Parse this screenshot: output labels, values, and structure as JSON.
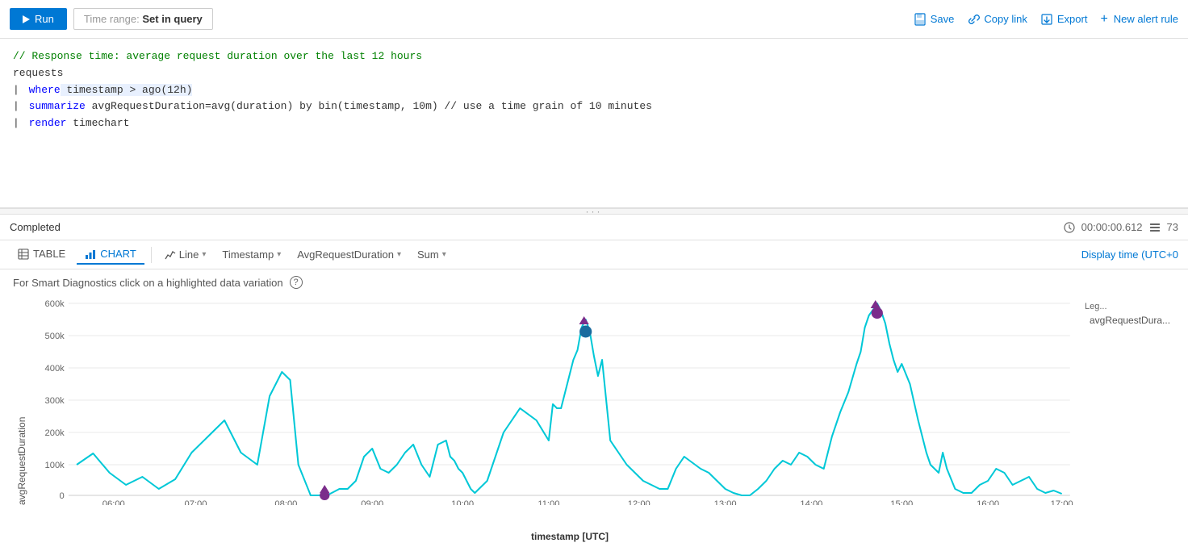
{
  "toolbar": {
    "run_label": "Run",
    "time_range_prefix": "Time range:",
    "time_range_value": "Set in query",
    "save_label": "Save",
    "copy_link_label": "Copy link",
    "export_label": "Export",
    "new_alert_label": "New alert rule"
  },
  "query": {
    "comment": "// Response time: average request duration over the last 12 hours",
    "line1": "requests",
    "line2_pipe": "|",
    "line2_keyword": "where",
    "line2_rest": " timestamp > ago(12h)",
    "line3_pipe": "|",
    "line3_keyword": "summarize",
    "line3_rest": " avgRequestDuration=avg(duration) by bin(timestamp, 10m) // use a time grain of 10 minutes",
    "line4_pipe": "|",
    "line4_keyword": "render",
    "line4_rest": " timechart"
  },
  "results": {
    "status": "Completed",
    "duration": "00:00:00.612",
    "rows": "73",
    "display_time": "Display time (UTC+0"
  },
  "tabs": {
    "table_label": "TABLE",
    "chart_label": "CHART",
    "line_label": "Line",
    "timestamp_label": "Timestamp",
    "avg_request_label": "AvgRequestDuration",
    "sum_label": "Sum"
  },
  "chart": {
    "smart_diagnostics_text": "For Smart Diagnostics click on a highlighted data variation",
    "y_axis_label": "avgRequestDuration",
    "x_axis_label": "timestamp [UTC]",
    "legend_label": "Leg...",
    "legend_series": "avgRequestDura...",
    "y_ticks": [
      "600k",
      "500k",
      "400k",
      "300k",
      "200k",
      "100k",
      "0"
    ],
    "x_ticks": [
      "06:00",
      "07:00",
      "08:00",
      "09:00",
      "10:00",
      "11:00",
      "12:00",
      "13:00",
      "14:00",
      "15:00",
      "16:00",
      "17:00"
    ]
  }
}
